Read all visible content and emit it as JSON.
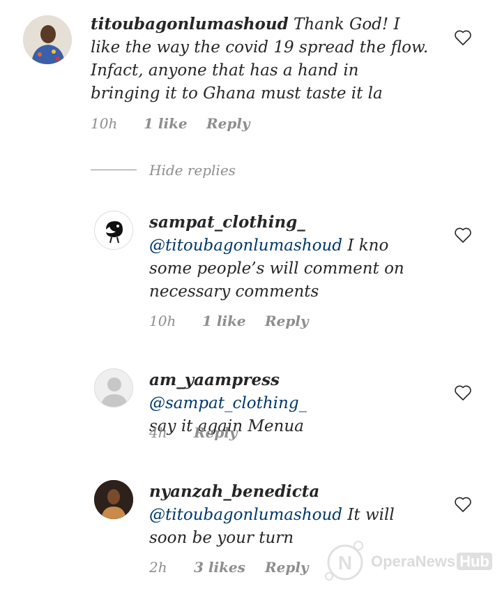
{
  "comments": [
    {
      "username": "titoubagonlumashoud",
      "mention": "",
      "text": "Thank God! I like the way the covid 19 spread the flow. Infact, anyone that has a hand in bringing it to Ghana must taste it la",
      "time": "10h",
      "likes": "1 like",
      "reply": "Reply",
      "avatar_icon": "user-photo-avatar"
    },
    {
      "username": "sampat_clothing_",
      "mention": "@titoubagonlumashoud",
      "text": "I kno some people’s will comment on necessary comments",
      "time": "10h",
      "likes": "1 like",
      "reply": "Reply",
      "avatar_icon": "bird-logo-avatar"
    },
    {
      "username": "am_yaampress",
      "mention": "@sampat_clothing_",
      "text": "say it again Menua",
      "time": "4h",
      "likes": "",
      "reply": "Reply",
      "avatar_icon": "default-avatar"
    },
    {
      "username": "nyanzah_benedicta",
      "mention": "@titoubagonlumashoud",
      "text": "It will soon be your turn",
      "time": "2h",
      "likes": "3 likes",
      "reply": "Reply",
      "avatar_icon": "user-photo-avatar"
    }
  ],
  "hide_replies": "Hide replies",
  "watermark": {
    "brand": "OperaNews",
    "hub": "Hub"
  },
  "colors": {
    "text": "#262626",
    "meta": "#8e8e8e",
    "mention": "#00376b"
  }
}
